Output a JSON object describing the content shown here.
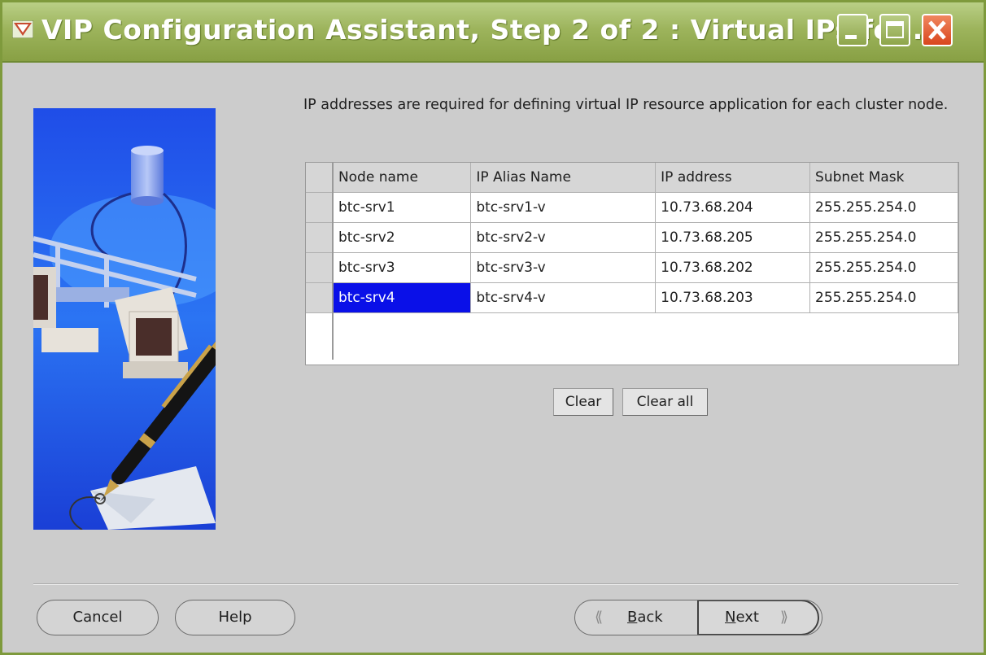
{
  "window": {
    "title": "VIP Configuration Assistant, Step 2 of 2 : Virtual IPs for..."
  },
  "description": "IP addresses are required for defining virtual IP resource application for each cluster node.",
  "table": {
    "columns": [
      "Node name",
      "IP Alias Name",
      "IP address",
      "Subnet Mask"
    ],
    "rows": [
      [
        "btc-srv1",
        "btc-srv1-v",
        "10.73.68.204",
        "255.255.254.0"
      ],
      [
        "btc-srv2",
        "btc-srv2-v",
        "10.73.68.205",
        "255.255.254.0"
      ],
      [
        "btc-srv3",
        "btc-srv3-v",
        "10.73.68.202",
        "255.255.254.0"
      ],
      [
        "btc-srv4",
        "btc-srv4-v",
        "10.73.68.203",
        "255.255.254.0"
      ]
    ],
    "selected_cell": "btc-srv4"
  },
  "buttons": {
    "clear": "Clear",
    "clear_all": "Clear all",
    "cancel": "Cancel",
    "help": "Help",
    "back_mnemonic": "B",
    "back_rest": "ack",
    "next_mnemonic": "N",
    "next_rest": "ext"
  },
  "icons": {
    "app": "oracle-x-icon",
    "back": "double-chevron-left-icon",
    "next": "double-chevron-right-icon"
  },
  "colors": {
    "titlebar": "#9db45c",
    "selection": "#0a10e8",
    "close": "#d9461d"
  }
}
